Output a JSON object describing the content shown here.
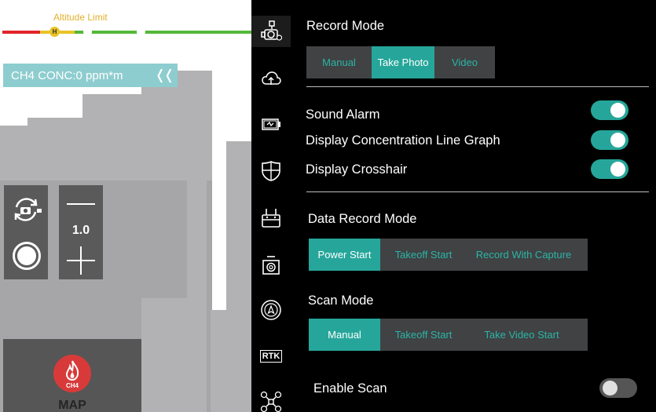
{
  "camera_view": {
    "altitude_label": "Altitude Limit",
    "altitude_marker": "H",
    "ch4_label": "CH4 CONC",
    "ch4_separator": ":",
    "ch4_value": "0 ppm*m",
    "collapse_glyph": "❬❬",
    "zoom_value": "1.0",
    "map_icon_text": "CH4",
    "map_label": "MAP"
  },
  "rail": {
    "items": [
      {
        "icon": "camera-gimbal-icon",
        "active": true
      },
      {
        "icon": "cloud-upload-icon"
      },
      {
        "icon": "battery-icon"
      },
      {
        "icon": "shield-icon"
      },
      {
        "icon": "remote-controller-icon"
      },
      {
        "icon": "camera-lens-icon"
      },
      {
        "icon": "navigation-icon"
      },
      {
        "icon": "rtk-icon",
        "label": "RTK"
      },
      {
        "icon": "drone-icon"
      }
    ]
  },
  "settings": {
    "record_mode": {
      "title": "Record Mode",
      "options": [
        "Manual",
        "Take Photo",
        "Video"
      ],
      "selected": "Take Photo"
    },
    "toggles": [
      {
        "label": "Sound Alarm",
        "on": true
      },
      {
        "label": "Display Concentration Line Graph",
        "on": true
      },
      {
        "label": "Display Crosshair",
        "on": true
      }
    ],
    "data_record_mode": {
      "title": "Data Record Mode",
      "options": [
        "Power Start",
        "Takeoff Start",
        "Record With Capture"
      ],
      "selected": "Power Start"
    },
    "scan_mode": {
      "title": "Scan Mode",
      "options": [
        "Manual",
        "Takeoff Start",
        "Take Video Start"
      ],
      "selected": "Manual"
    },
    "enable_scan": {
      "label": "Enable Scan",
      "on": false
    }
  },
  "colors": {
    "accent": "#26a69a",
    "accent_text": "#2bb5a6",
    "panel_bg": "#000000",
    "segment_bg": "#404244",
    "altitude_red": "#e0242a",
    "altitude_yellow": "#e8c426",
    "altitude_green": "#55b83a",
    "ch4_banner": "#8ecdcf",
    "map_icon": "#d83a3a"
  }
}
